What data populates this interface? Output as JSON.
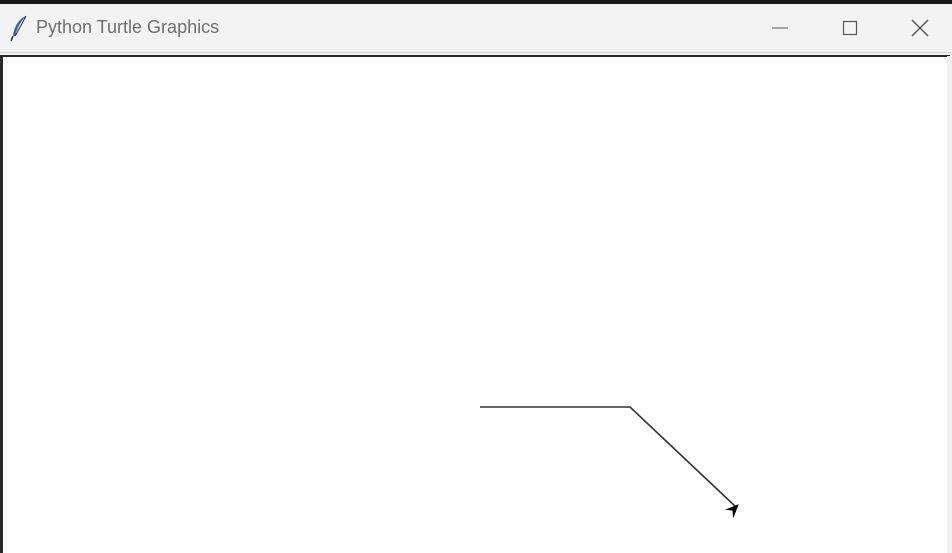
{
  "window": {
    "title": "Python Turtle Graphics",
    "icon": "feather-icon",
    "controls": [
      "minimize-icon",
      "maximize-icon",
      "close-icon"
    ]
  },
  "canvas": {
    "background": "#ffffff",
    "pen_color": "#333333",
    "turtle_color": "#000000",
    "turtle_shape": "classic-arrow",
    "path": [
      [
        0,
        -1
      ],
      [
        150,
        -1
      ],
      [
        256,
        -101
      ]
    ],
    "turtle_heading_deg": 45
  }
}
